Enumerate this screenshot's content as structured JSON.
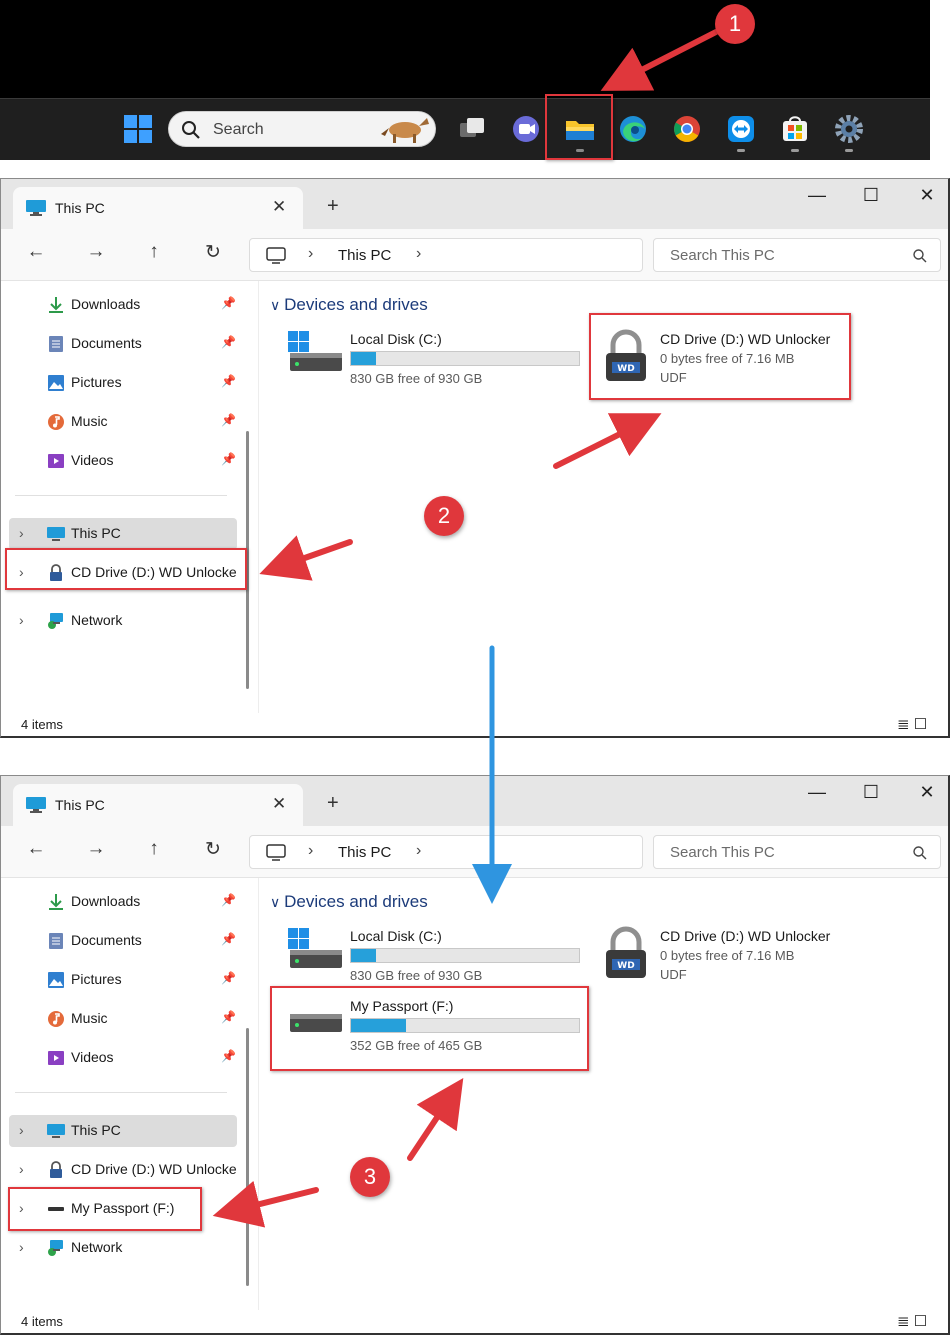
{
  "taskbar": {
    "search_label": "Search",
    "apps": [
      {
        "name": "start",
        "icon": "windows-logo-icon"
      },
      {
        "name": "task-view",
        "icon": "task-view-icon"
      },
      {
        "name": "chat",
        "icon": "teams-chat-icon"
      },
      {
        "name": "file-explorer",
        "icon": "folder-icon"
      },
      {
        "name": "edge",
        "icon": "edge-icon"
      },
      {
        "name": "chrome",
        "icon": "chrome-icon"
      },
      {
        "name": "teamviewer",
        "icon": "teamviewer-icon"
      },
      {
        "name": "store",
        "icon": "store-icon"
      },
      {
        "name": "settings",
        "icon": "gear-icon"
      }
    ]
  },
  "windows": [
    {
      "tab_title": "This PC",
      "address": "This PC",
      "search_placeholder": "Search This PC",
      "sidebar": {
        "quick": [
          "Downloads",
          "Documents",
          "Pictures",
          "Music",
          "Videos"
        ],
        "this_pc": "This PC",
        "devices": [
          "CD Drive (D:) WD Unlocke"
        ],
        "network": "Network"
      },
      "group_title": "Devices and drives",
      "drives": [
        {
          "name": "Local Disk (C:)",
          "free": "830 GB free of 930 GB",
          "used_fraction": 0.11
        },
        {
          "name": "CD Drive (D:) WD Unlocker",
          "free": "0 bytes free of 7.16 MB",
          "fs": "UDF"
        }
      ],
      "status": "4 items"
    },
    {
      "tab_title": "This PC",
      "address": "This PC",
      "search_placeholder": "Search This PC",
      "sidebar": {
        "quick": [
          "Downloads",
          "Documents",
          "Pictures",
          "Music",
          "Videos"
        ],
        "this_pc": "This PC",
        "devices": [
          "CD Drive (D:) WD Unlocke",
          "My Passport (F:)"
        ],
        "network": "Network"
      },
      "group_title": "Devices and drives",
      "drives": [
        {
          "name": "Local Disk (C:)",
          "free": "830 GB free of 930 GB",
          "used_fraction": 0.11
        },
        {
          "name": "CD Drive (D:) WD Unlocker",
          "free": "0 bytes free of 7.16 MB",
          "fs": "UDF"
        },
        {
          "name": "My Passport (F:)",
          "free": "352 GB free of 465 GB",
          "used_fraction": 0.24
        }
      ],
      "status": "4 items"
    }
  ],
  "annotations": {
    "steps": [
      "1",
      "2",
      "3"
    ],
    "highlight_color": "#e0373c",
    "flow_arrow_color": "#2f95e0"
  }
}
